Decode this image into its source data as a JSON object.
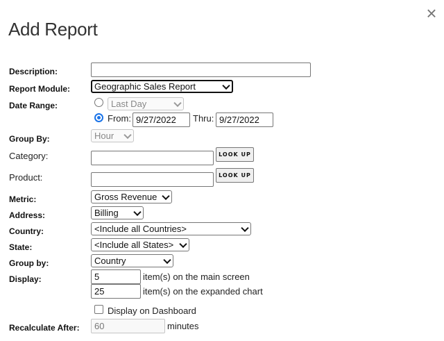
{
  "dialog": {
    "title": "Add Report",
    "close_label": "×"
  },
  "labels": {
    "description": "Description:",
    "report_module": "Report Module:",
    "date_range": "Date Range:",
    "group_by": "Group By:",
    "category": "Category:",
    "product": "Product:",
    "metric": "Metric:",
    "address": "Address:",
    "country": "Country:",
    "state": "State:",
    "group_by_2": "Group by:",
    "display": "Display:",
    "recalculate_after": "Recalculate After:"
  },
  "fields": {
    "description_value": "",
    "report_module_value": "Geographic Sales Report",
    "date_preset_value": "Last Day",
    "date_from_label": "From:",
    "date_from_value": "9/27/2022",
    "date_thru_label": "Thru:",
    "date_thru_value": "9/27/2022",
    "group_by_value": "Hour",
    "category_value": "",
    "product_value": "",
    "lookup_label": "LOOK UP",
    "metric_value": "Gross Revenue",
    "address_value": "Billing",
    "country_value": "<Include all Countries>",
    "state_value": "<Include all States>",
    "group_by_2_value": "Country",
    "display_main_value": "5",
    "display_main_suffix": "item(s) on the main screen",
    "display_expanded_value": "25",
    "display_expanded_suffix": "item(s) on the expanded chart",
    "dashboard_label": "Display on Dashboard",
    "recalculate_value": "60",
    "recalculate_suffix": "minutes"
  },
  "state": {
    "date_mode": "from",
    "display_on_dashboard": false
  },
  "colors": {
    "radio_accent": "#1a73e8",
    "label_text": "#111111"
  }
}
